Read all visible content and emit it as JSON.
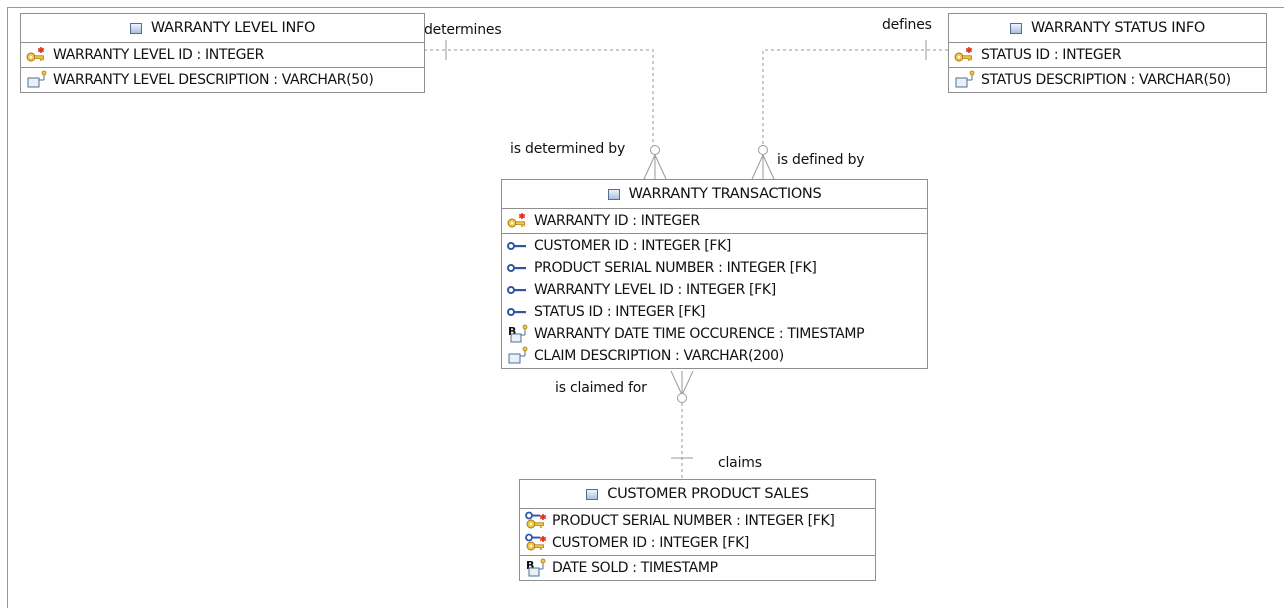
{
  "entities": {
    "warranty_level_info": {
      "title": "WARRANTY LEVEL INFO",
      "pk": [
        "WARRANTY LEVEL ID : INTEGER"
      ],
      "attrs": [
        "WARRANTY LEVEL DESCRIPTION : VARCHAR(50)"
      ]
    },
    "warranty_status_info": {
      "title": "WARRANTY STATUS INFO",
      "pk": [
        "STATUS ID : INTEGER"
      ],
      "attrs": [
        "STATUS DESCRIPTION : VARCHAR(50)"
      ]
    },
    "warranty_transactions": {
      "title": "WARRANTY TRANSACTIONS",
      "pk": [
        "WARRANTY ID : INTEGER"
      ],
      "attrs": [
        "CUSTOMER ID : INTEGER [FK]",
        "PRODUCT SERIAL NUMBER : INTEGER [FK]",
        "WARRANTY LEVEL ID : INTEGER [FK]",
        "STATUS ID : INTEGER [FK]",
        "WARRANTY DATE TIME OCCURENCE : TIMESTAMP",
        "CLAIM DESCRIPTION : VARCHAR(200)"
      ]
    },
    "customer_product_sales": {
      "title": "CUSTOMER PRODUCT SALES",
      "pk": [
        "PRODUCT SERIAL NUMBER : INTEGER [FK]",
        "CUSTOMER ID : INTEGER [FK]"
      ],
      "attrs": [
        "DATE SOLD : TIMESTAMP"
      ]
    }
  },
  "relationships": {
    "determines": "determines",
    "is_determined_by": "is determined by",
    "defines": "defines",
    "is_defined_by": "is defined by",
    "is_claimed_for": "is claimed for",
    "claims": "claims"
  },
  "icons": {
    "table": "table-icon",
    "primary_key": "primary-key-icon",
    "foreign_key": "foreign-key-icon",
    "pk_fk": "primary-foreign-key-icon",
    "attribute": "attribute-icon",
    "timestamp_attribute": "timestamp-attribute-icon"
  },
  "colors": {
    "border": "#8f8f8f",
    "connector": "#9a9a9a",
    "key_gold": "#d8a21c",
    "fk_blue": "#2f57a8",
    "table_icon_blue": "#4f6f94"
  }
}
